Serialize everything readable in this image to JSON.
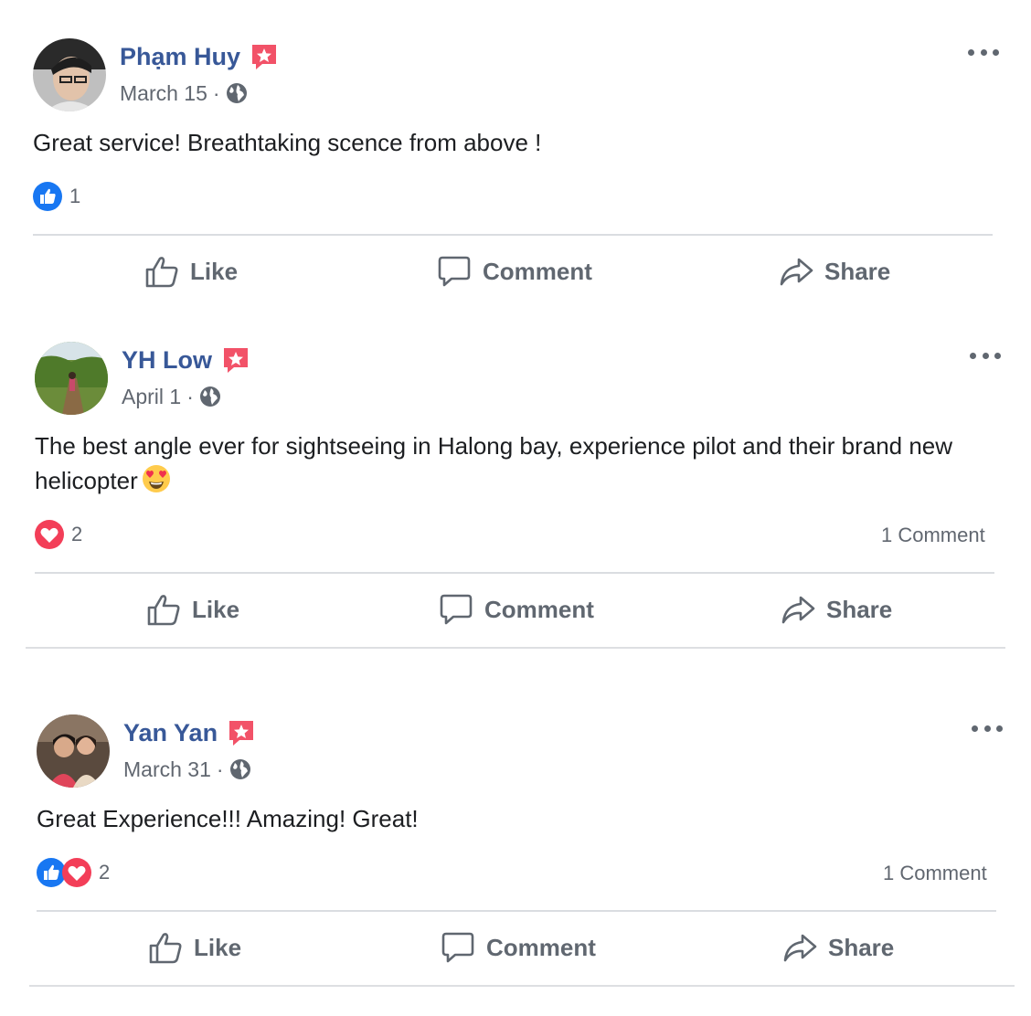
{
  "posts": [
    {
      "author": "Phạm Huy",
      "date": "March 15",
      "separator": "·",
      "text": "Great service! Breathtaking scence from above !",
      "reactions": [
        "like"
      ],
      "reaction_count": "1",
      "comments_label": "",
      "actions": {
        "like": "Like",
        "comment": "Comment",
        "share": "Share"
      }
    },
    {
      "author": "YH Low",
      "date": "April 1",
      "separator": "·",
      "text": "The best angle ever for sightseeing in Halong bay, experience pilot and their brand new helicopter",
      "text_emoji": "heart-eyes-emoji",
      "reactions": [
        "love"
      ],
      "reaction_count": "2",
      "comments_label": "1 Comment",
      "actions": {
        "like": "Like",
        "comment": "Comment",
        "share": "Share"
      }
    },
    {
      "author": "Yan Yan",
      "date": "March 31",
      "separator": "·",
      "text": "Great Experience!!! Amazing! Great!",
      "reactions": [
        "like",
        "love"
      ],
      "reaction_count": "2",
      "comments_label": "1 Comment",
      "actions": {
        "like": "Like",
        "comment": "Comment",
        "share": "Share"
      }
    }
  ],
  "colors": {
    "name": "#385898",
    "meta": "#616770",
    "like_blue": "#1877f2",
    "love_red": "#f33e58",
    "badge": "#f25268",
    "divider": "#dadde1"
  },
  "icons": {
    "badge": "recommendation-badge-icon",
    "privacy": "globe-icon",
    "more": "more-options-icon",
    "like": "thumbs-up-icon",
    "comment": "comment-bubble-icon",
    "share": "share-arrow-icon"
  }
}
